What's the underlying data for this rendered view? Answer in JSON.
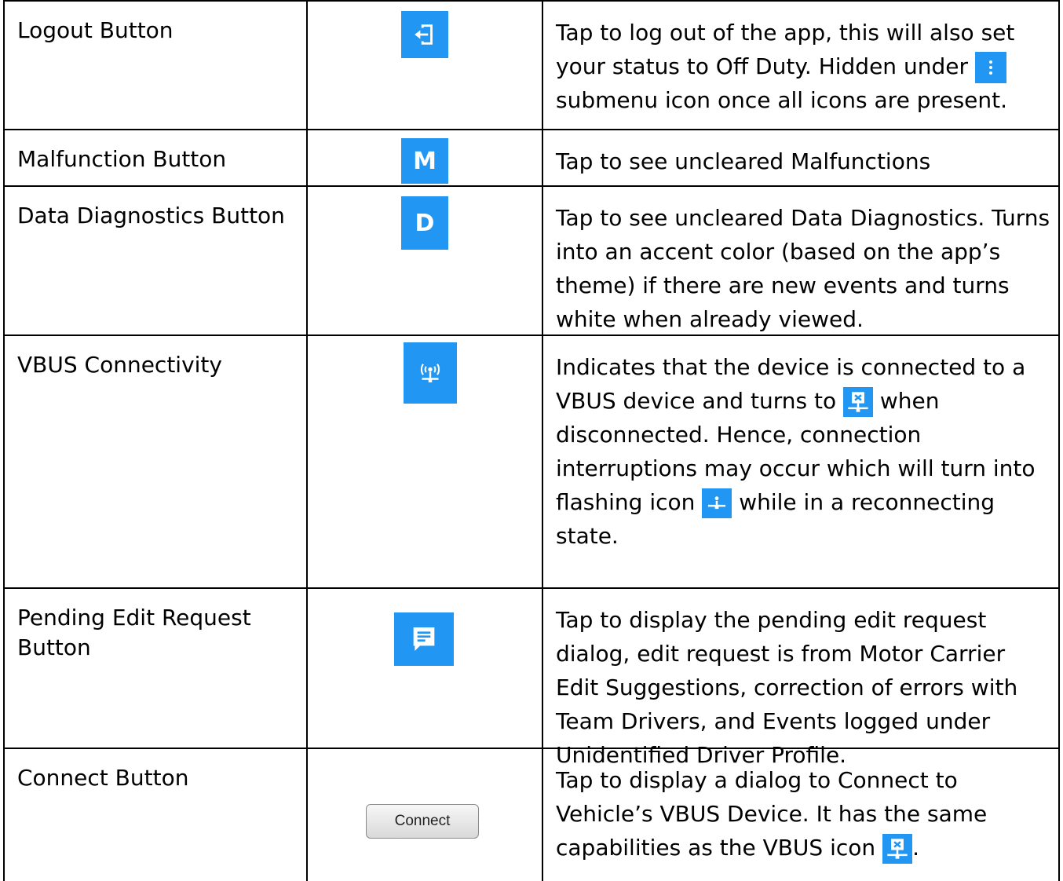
{
  "rows": [
    {
      "name": "Logout Button",
      "icon": "logout-icon",
      "desc_parts": [
        "Tap to log out of the app, this will also set your status to Off Duty. Hidden under",
        "submenu icon once all icons are present."
      ]
    },
    {
      "name": "Malfunction Button",
      "icon": "malfunction-m-icon",
      "icon_letter": "M",
      "desc": "Tap to see uncleared Malfunctions"
    },
    {
      "name": "Data Diagnostics Button",
      "icon": "data-diagnostics-d-icon",
      "icon_letter": "D",
      "desc": "Tap to see uncleared Data Diagnostics. Turns into an accent color (based on the app’s theme) if there are new events and turns white when already viewed."
    },
    {
      "name": "VBUS Connectivity",
      "icon": "vbus-connected-icon",
      "desc_parts": [
        "Indicates that the device is connected to a VBUS device and turns to",
        "when disconnected. Hence, connection interruptions may occur which will turn into flashing icon",
        "while in a reconnecting state."
      ]
    },
    {
      "name": "Pending Edit Request Button",
      "icon": "edit-request-message-icon",
      "desc": "Tap to display the pending edit request dialog, edit request is from Motor Carrier Edit Suggestions, correction of errors with Team Drivers, and Events logged under Unidentified Driver Profile."
    },
    {
      "name": "Connect Button",
      "button_label": "Connect",
      "desc_parts": [
        "Tap to display a dialog to Connect to Vehicle’s VBUS Device. It has the same capabilities as the VBUS icon",
        "."
      ]
    }
  ],
  "colors": {
    "icon_blue": "#2196f3",
    "border": "#000000"
  }
}
